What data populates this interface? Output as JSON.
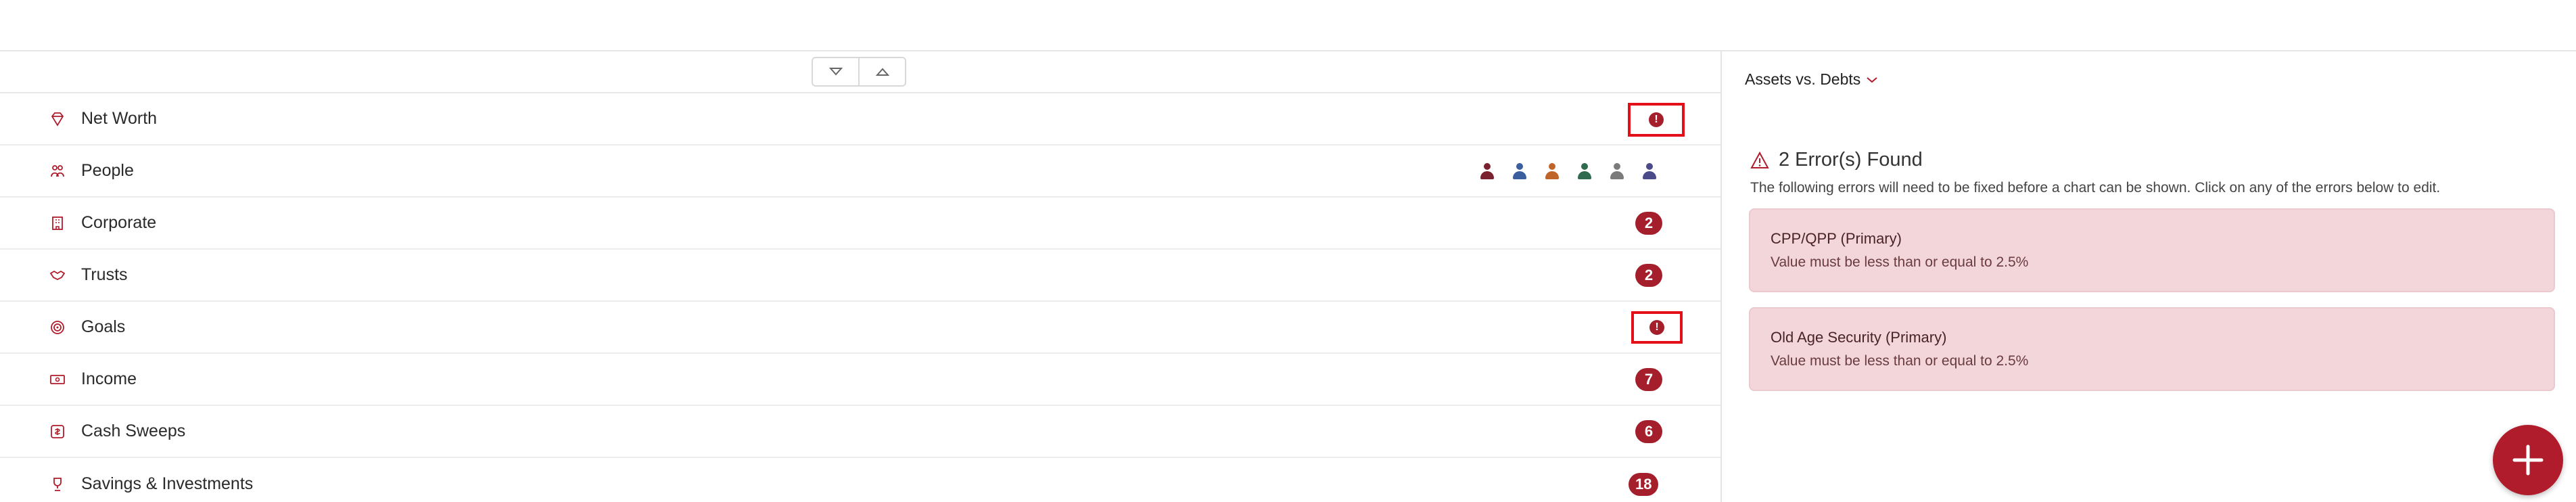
{
  "nav": {
    "rows": [
      {
        "label": "Net Worth",
        "icon": "diamond-icon"
      },
      {
        "label": "People",
        "icon": "people-icon"
      },
      {
        "label": "Corporate",
        "icon": "building-icon",
        "count": "2"
      },
      {
        "label": "Trusts",
        "icon": "handshake-icon",
        "count": "2"
      },
      {
        "label": "Goals",
        "icon": "target-icon"
      },
      {
        "label": "Income",
        "icon": "money-icon",
        "count": "7"
      },
      {
        "label": "Cash Sweeps",
        "icon": "cash-sweep-icon",
        "count": "6"
      },
      {
        "label": "Savings & Investments",
        "icon": "trophy-icon",
        "count": "18"
      }
    ],
    "error_marker": "!",
    "people_avatar_colors": [
      "#7a2230",
      "#3a5e9e",
      "#c0652a",
      "#2f6b4f",
      "#7b7b7b",
      "#4b4b8a"
    ]
  },
  "panel": {
    "chart_select": "Assets vs. Debts",
    "errors_title": "2 Error(s) Found",
    "errors_desc": "The following errors will need to be fixed before a chart can be shown. Click on any of the errors below to edit.",
    "errors": [
      {
        "title": "CPP/QPP (Primary)",
        "message": "Value must be less than or equal to 2.5%"
      },
      {
        "title": "Old Age Security (Primary)",
        "message": "Value must be less than or equal to 2.5%"
      }
    ]
  },
  "colors": {
    "accent": "#a51e2c",
    "error_outline": "#e3101a",
    "error_card_bg": "#f2d6da"
  }
}
